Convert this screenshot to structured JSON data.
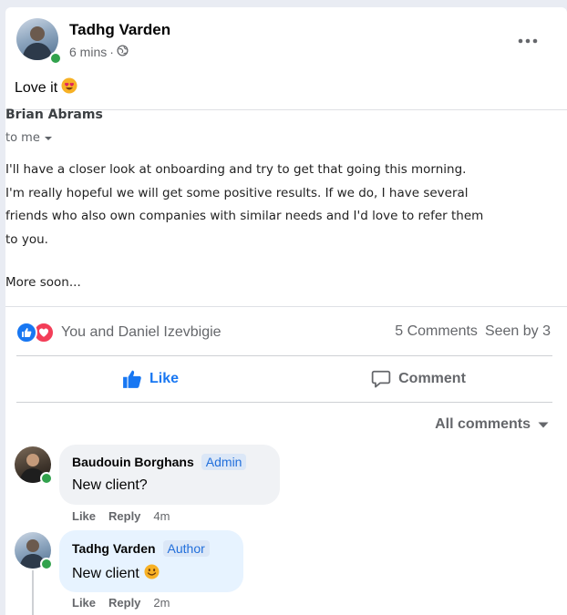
{
  "post": {
    "author": "Tadhg Varden",
    "time": "6 mins",
    "time_separator": "·",
    "privacy_icon": "globe-icon",
    "text": "Love it",
    "emoji": "heart-eyes-emoji"
  },
  "email": {
    "from": "Brian Abrams",
    "to": "to me",
    "paragraph_lines": [
      "I'll have a closer look at onboarding and try to get that going this morning.",
      "I'm really hopeful we will get some positive results. If we do, I have several",
      "friends who also own companies with similar needs and I'd love to refer them",
      "to you."
    ],
    "signoff": "More soon..."
  },
  "reactions": {
    "icons": [
      "like-reaction-icon",
      "love-reaction-icon"
    ],
    "text": "You and Daniel Izevbigie",
    "comments_count": "5 Comments",
    "seen_by": "Seen by 3"
  },
  "actions": {
    "like": "Like",
    "comment": "Comment"
  },
  "filter": {
    "label": "All comments"
  },
  "comments": [
    {
      "name": "Baudouin Borghans",
      "badge": "Admin",
      "text": "New client?",
      "like": "Like",
      "reply": "Reply",
      "time": "4m"
    },
    {
      "name": "Tadhg Varden",
      "badge": "Author",
      "text": "New client",
      "emoji": "smile-emoji",
      "like": "Like",
      "reply": "Reply",
      "time": "2m"
    }
  ],
  "colors": {
    "accent": "#1877f2",
    "secondary_text": "#65676b",
    "online": "#31a24c",
    "love": "#f33e58"
  }
}
